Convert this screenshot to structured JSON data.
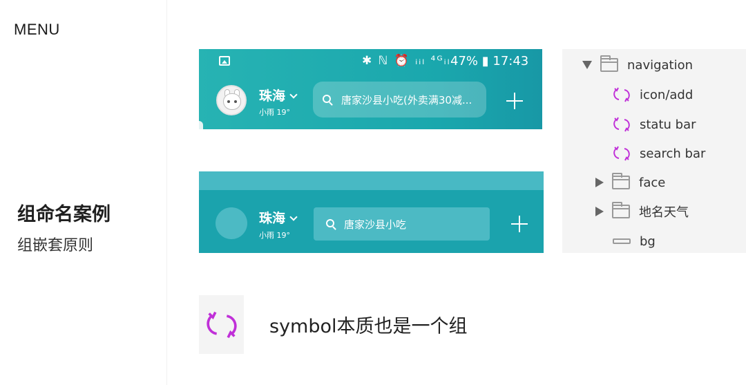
{
  "sidebar": {
    "menu_label": "MENU",
    "section_title": "组命名案例",
    "section_subtitle": "组嵌套原则"
  },
  "mock_designed": {
    "status_icons": "✱ ℕ ⏰ ᵢᵢₗ ⁴ᴳᵢₗ",
    "battery": "47%",
    "time": "17:43",
    "city": "珠海",
    "weather": "小雨 19°",
    "search_text": "唐家沙县小吃(外卖满30减...",
    "icons": [
      "image-icon",
      "avatar",
      "chevron-down-icon",
      "search-icon",
      "plus-icon"
    ]
  },
  "mock_wireframe": {
    "city": "珠海",
    "weather": "小雨 19°",
    "search_text": "唐家沙县小吃"
  },
  "layers": {
    "items": [
      {
        "label": "navigation",
        "type": "group-expanded"
      },
      {
        "label": "icon/add",
        "type": "symbol"
      },
      {
        "label": "statu bar",
        "type": "symbol"
      },
      {
        "label": "search bar",
        "type": "symbol"
      },
      {
        "label": "face",
        "type": "group-collapsed"
      },
      {
        "label": "地名天气",
        "type": "group-collapsed"
      },
      {
        "label": "bg",
        "type": "shape"
      }
    ]
  },
  "symbol_note": {
    "text": "symbol本质也是一个组"
  },
  "colors": {
    "teal": "#1ba3ad",
    "teal_light": "#4cbac4",
    "symbol_purple": "#c030d8",
    "panel_bg": "#f4f4f4"
  }
}
